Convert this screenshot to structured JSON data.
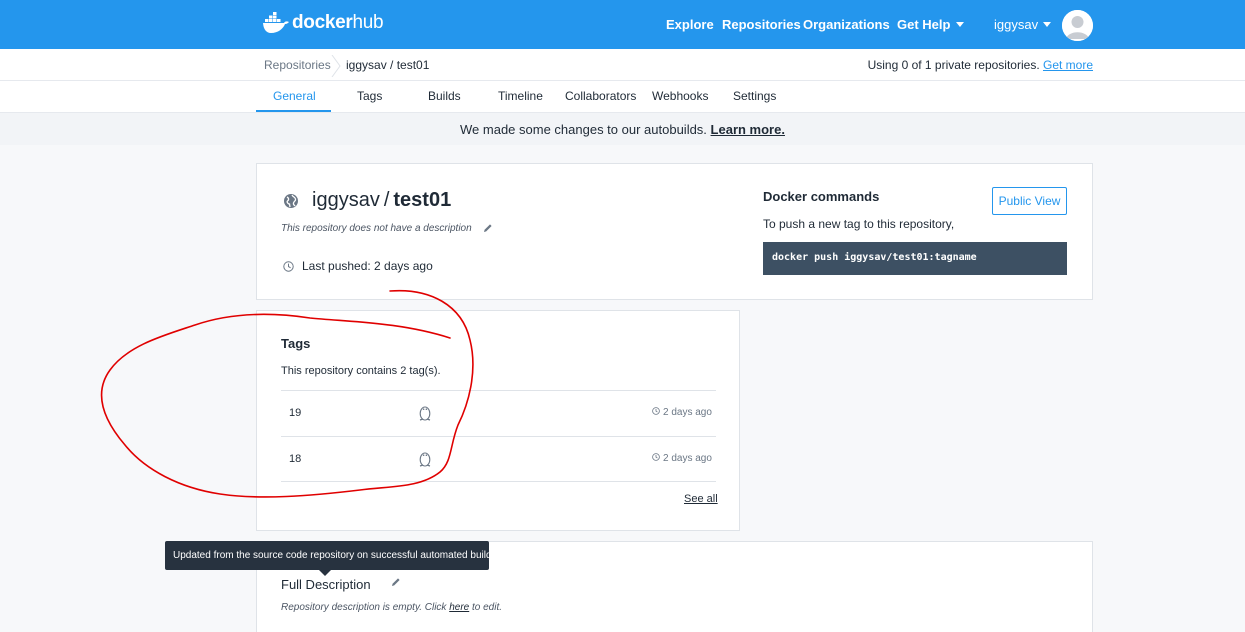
{
  "nav": {
    "brand_a": "docker",
    "brand_b": "hub",
    "links": [
      "Explore",
      "Repositories",
      "Organizations",
      "Get Help"
    ],
    "username": "iggysav",
    "icons": [
      "docker-whale-icon",
      "chevron-down-icon",
      "avatar-icon"
    ]
  },
  "breadcrumb": {
    "root": "Repositories",
    "current": "iggysav / test01"
  },
  "usage": {
    "text": "Using 0 of 1 private repositories. ",
    "link": "Get more"
  },
  "tabs": [
    "General",
    "Tags",
    "Builds",
    "Timeline",
    "Collaborators",
    "Webhooks",
    "Settings"
  ],
  "active_tab": "General",
  "banner": {
    "text": "We made some changes to our autobuilds. ",
    "link": "Learn more."
  },
  "repo": {
    "owner": "iggysav",
    "slash": "/",
    "name": "test01",
    "description": "This repository does not have a description",
    "last_pushed": "Last pushed: 2 days ago",
    "icons": [
      "globe-icon",
      "pencil-icon",
      "clock-icon"
    ]
  },
  "docker_commands": {
    "title": "Docker commands",
    "subtitle": "To push a new tag to this repository,",
    "command": "docker push iggysav/test01:tagname",
    "public_view": "Public View"
  },
  "tags": {
    "title": "Tags",
    "subtitle": "This repository contains 2 tag(s).",
    "rows": [
      {
        "name": "19",
        "age": "2 days ago"
      },
      {
        "name": "18",
        "age": "2 days ago"
      }
    ],
    "see_all": "See all",
    "icons": [
      "linux-penguin-icon",
      "clock-icon"
    ]
  },
  "full_description": {
    "title": "Full Description",
    "empty_prefix": "Repository description is empty. Click ",
    "here": "here",
    "empty_suffix": " to edit."
  },
  "tooltip": "Updated from the source code repository on successful automated build.",
  "colors": {
    "brand_blue": "#2496ed",
    "command_bg": "#3d5063",
    "tooltip_bg": "#27323f",
    "annotation_red": "#e00000"
  }
}
